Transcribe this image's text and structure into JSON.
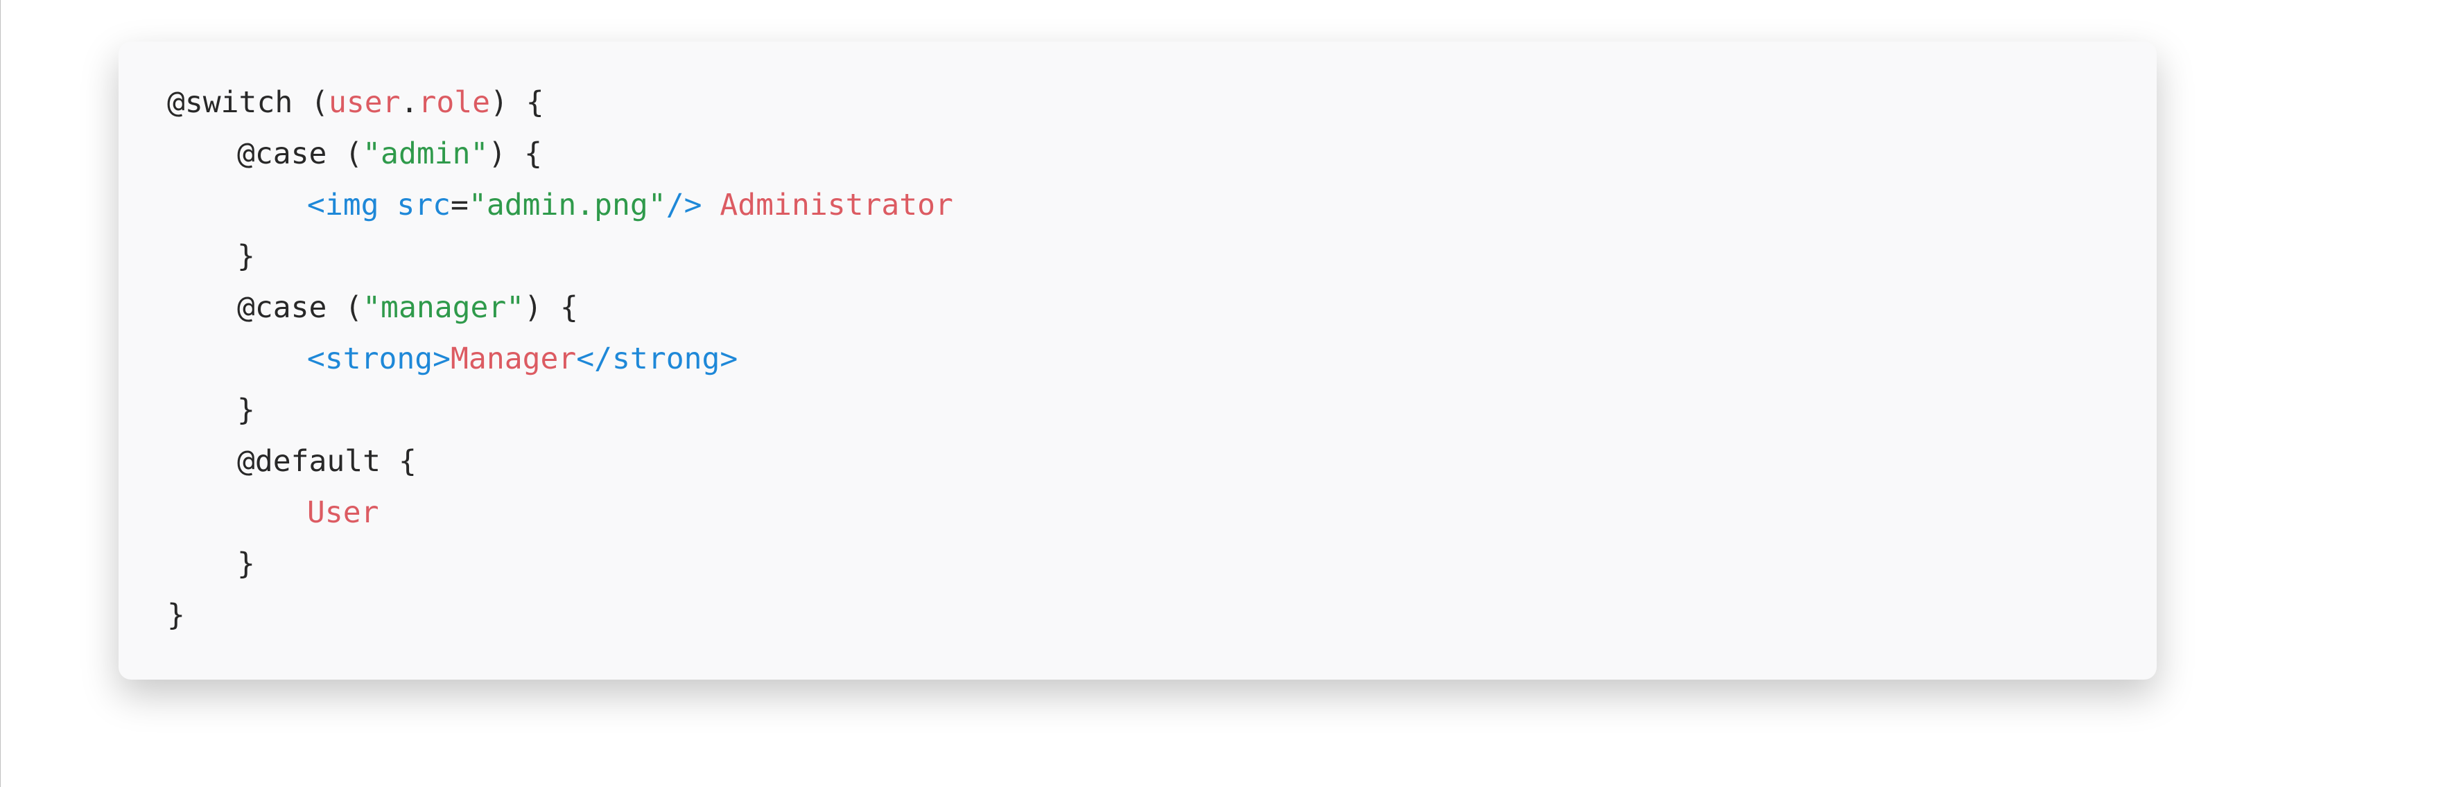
{
  "code": {
    "line1": {
      "a": "@switch (",
      "b": "user",
      "c": ".",
      "d": "role",
      "e": ") {"
    },
    "line2": {
      "a": "@case (",
      "b": "\"admin\"",
      "c": ") {"
    },
    "line3": {
      "a": "<",
      "b": "img",
      "c": " ",
      "d": "src",
      "e": "=",
      "f": "\"admin.png\"",
      "g": "/>",
      "h": " Administrator"
    },
    "line4": {
      "a": "}"
    },
    "line5": {
      "a": "@case (",
      "b": "\"manager\"",
      "c": ") {"
    },
    "line6": {
      "a": "<",
      "b": "strong",
      "c": ">",
      "d": "Manager",
      "e": "</",
      "f": "strong",
      "g": ">"
    },
    "line7": {
      "a": "}"
    },
    "line8": {
      "a": "@default {"
    },
    "line9": {
      "a": "User"
    },
    "line10": {
      "a": "}"
    },
    "line11": {
      "a": "}"
    }
  }
}
